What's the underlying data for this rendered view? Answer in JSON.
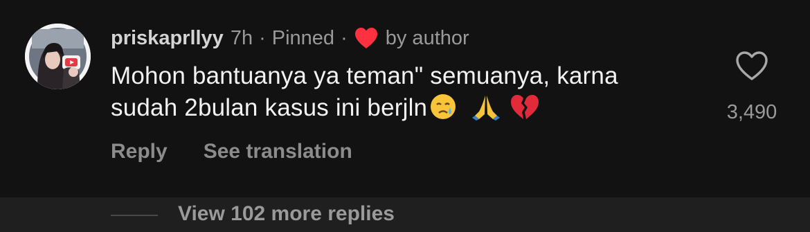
{
  "comment": {
    "username": "priskaprllyy",
    "time": "7h",
    "separator": "·",
    "pinned": "Pinned",
    "liked_by": "by author",
    "text_line1": "Mohon bantuanya ya teman\" semuanya, karna",
    "text_line2": "sudah 2bulan kasus ini berjln",
    "emojis": [
      "crying-face-icon",
      "folded-hands-icon",
      "broken-heart-icon"
    ],
    "reply_label": "Reply",
    "see_translation_label": "See translation",
    "like_count": "3,490"
  },
  "replies": {
    "label": "View 102 more replies"
  },
  "colors": {
    "background": "#121212",
    "bar_background": "#1f1f1f",
    "heart_red": "#ff3040"
  }
}
